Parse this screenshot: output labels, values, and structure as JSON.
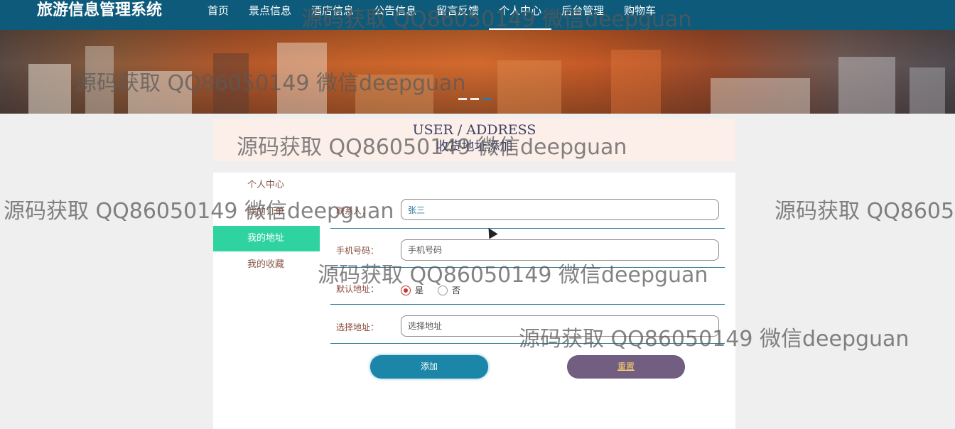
{
  "app": {
    "title": "旅游信息管理系统"
  },
  "nav": {
    "items": [
      {
        "label": "首页"
      },
      {
        "label": "景点信息"
      },
      {
        "label": "酒店信息"
      },
      {
        "label": "公告信息"
      },
      {
        "label": "留言反馈"
      },
      {
        "label": "个人中心"
      },
      {
        "label": "后台管理"
      },
      {
        "label": "购物车"
      }
    ],
    "active_index": 5
  },
  "banner": {
    "slide_count": 3,
    "active_slide": 3
  },
  "header": {
    "en": "USER / ADDRESS",
    "cn": "收货地址添加"
  },
  "sidebar": {
    "items": [
      {
        "label": "个人中心"
      },
      {
        "label": "我的订单"
      },
      {
        "label": "我的地址"
      },
      {
        "label": "我的收藏"
      }
    ],
    "active_index": 2
  },
  "form": {
    "contact": {
      "label": "联系人：",
      "value": "张三"
    },
    "phone": {
      "label": "手机号码：",
      "placeholder": "手机号码"
    },
    "default": {
      "label": "默认地址：",
      "options": [
        "是",
        "否"
      ],
      "selected": "是"
    },
    "address": {
      "label": "选择地址：",
      "placeholder": "选择地址"
    },
    "add_label": "添加",
    "reset_label": "重置"
  },
  "watermark": {
    "text": "源码获取 QQ86050149 微信deepguan",
    "text_cut": "源码获取 QQ860501"
  },
  "colors": {
    "topbar": "#0d5a7a",
    "sidebar_active": "#2ed3a0",
    "add_button": "#1c86a8",
    "reset_button": "#725e80",
    "reset_text": "#ffd66b",
    "header_panel": "#fcefe9"
  }
}
